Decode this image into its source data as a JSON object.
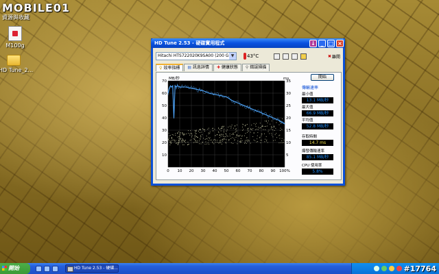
{
  "watermark": {
    "brand": "MOBILE01",
    "subtitle": "資源與收藏"
  },
  "desktop": {
    "icons": [
      {
        "label": "M100g"
      },
      {
        "label": "HD Tune_2..."
      }
    ]
  },
  "window": {
    "title": "HD Tune 2.53 - 硬碟實用程式",
    "drive": "Hitachi HTS722020K9SA00 (200 GB)",
    "temperature": "43°C",
    "exit_label": "離開",
    "tabs": [
      {
        "label": "效率指標",
        "active": true
      },
      {
        "label": "訊息詳情",
        "active": false
      },
      {
        "label": "健康狀態",
        "active": false
      },
      {
        "label": "錯誤掃描",
        "active": false
      }
    ],
    "start_button": "開始",
    "transfer_rate_title": "傳輸速率",
    "stats": {
      "min_label": "最小值",
      "min_value": "13.1 MB/秒",
      "max_label": "最大值",
      "max_value": "66.9 MB/秒",
      "avg_label": "平均值",
      "avg_value": "52.8 MB/秒",
      "access_label": "存取時間",
      "access_value": "14.7 ms",
      "burst_label": "爆發傳輸速率",
      "burst_value": "85.1 MB/秒",
      "cpu_label": "CPU 使用率",
      "cpu_value": "5.8%"
    }
  },
  "chart_data": {
    "type": "line",
    "ylabel": "MB/秒",
    "y2label": "ms",
    "x_ticks": [
      "0",
      "10",
      "20",
      "30",
      "40",
      "50",
      "60",
      "70",
      "80",
      "90",
      "100%"
    ],
    "y_ticks": [
      "10",
      "20",
      "30",
      "40",
      "50",
      "60",
      "70"
    ],
    "y2_ticks": [
      "5",
      "10",
      "15",
      "20",
      "25",
      "30",
      "35"
    ],
    "ylim": [
      0,
      70
    ],
    "y2lim": [
      0,
      35
    ],
    "xlim": [
      0,
      100
    ],
    "series": [
      {
        "color": "#4fa8ff",
        "x": [
          0,
          1,
          2,
          3,
          4,
          5,
          6,
          7,
          8,
          10,
          15,
          20,
          25,
          30,
          35,
          40,
          45,
          50,
          55,
          60,
          65,
          70,
          75,
          80,
          85,
          90,
          95,
          100
        ],
        "y": [
          60,
          64,
          66,
          65,
          66,
          40,
          66,
          65,
          66,
          65,
          65,
          64,
          63,
          62,
          60,
          59,
          58,
          57,
          54,
          52,
          50,
          48,
          46,
          44,
          42,
          40,
          38,
          35
        ]
      }
    ],
    "scatter_note_color": "#c8c8a0",
    "grid": true
  },
  "taskbar": {
    "start_label": "開始",
    "task_button": "HD Tune 2.53 - 硬碟...",
    "tray_id": "#17764"
  }
}
